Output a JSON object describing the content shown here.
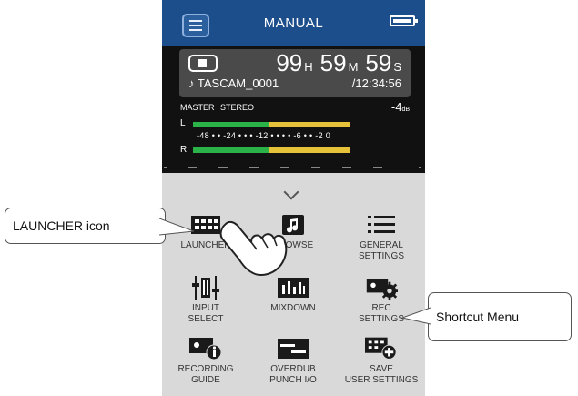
{
  "header": {
    "title": "MANUAL",
    "menu_icon": "hamburger-menu-icon",
    "battery_icon": "battery-icon"
  },
  "recorder": {
    "stop_icon": "stop-icon",
    "hours": "99",
    "hours_unit": "H",
    "minutes": "59",
    "minutes_unit": "M",
    "seconds": "59",
    "seconds_unit": "S",
    "file_name": "♪ TASCAM_0001",
    "total_time": "/12:34:56"
  },
  "meter": {
    "master_label": "MASTER",
    "mode_label": "STEREO",
    "level": "-4",
    "level_unit": "dB",
    "left_label": "L",
    "right_label": "R",
    "scale": "-48 • • -24 • • • -12 • • • • -6 • • -2 0",
    "left_fill": 0.78,
    "right_fill": 0.78,
    "green_fraction": 0.5
  },
  "shortcut_menu": {
    "items": [
      {
        "label": "LAUNCHER",
        "icon": "launcher-grid-icon"
      },
      {
        "label": "BROWSE",
        "icon": "music-note-folder-icon"
      },
      {
        "label": "GENERAL\nSETTINGS",
        "icon": "list-icon"
      },
      {
        "label": "INPUT\nSELECT",
        "icon": "input-select-icon"
      },
      {
        "label": "MIXDOWN",
        "icon": "mixdown-icon"
      },
      {
        "label": "REC\nSETTINGS",
        "icon": "rec-settings-gear-icon"
      },
      {
        "label": "RECORDING\nGUIDE",
        "icon": "recording-guide-info-icon"
      },
      {
        "label": "OVERDUB\nPUNCH I/O",
        "icon": "overdub-icon"
      },
      {
        "label": "SAVE\nUSER SETTINGS",
        "icon": "save-user-settings-icon"
      }
    ]
  },
  "annotations": {
    "launcher_callout": "LAUNCHER icon",
    "shortcut_callout": "Shortcut Menu"
  },
  "colors": {
    "header_bg": "#1d4e8c",
    "meter_green": "#2bb34a",
    "meter_yellow": "#e6c23a",
    "menu_bg": "#d9d9d9"
  }
}
